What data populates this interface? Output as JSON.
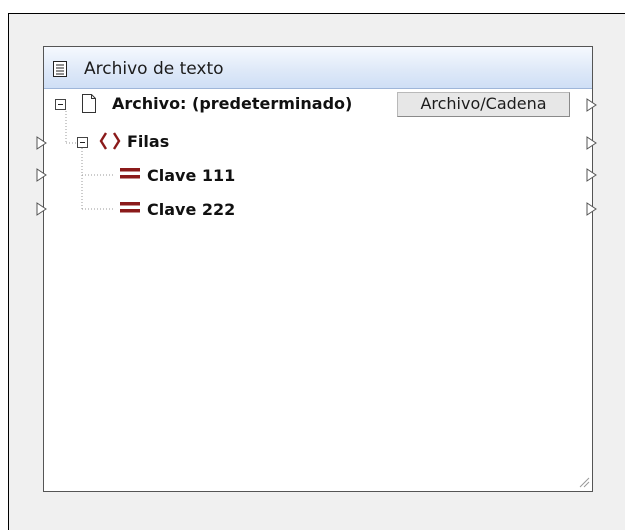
{
  "component": {
    "title": "Archivo de texto",
    "root": {
      "label": "Archivo: (predeterminado)",
      "button_label": "Archivo/Cadena"
    },
    "group": {
      "label": "Filas"
    },
    "fields": [
      {
        "label": "Clave 111"
      },
      {
        "label": "Clave 222"
      }
    ]
  },
  "icons": {
    "title": "text-file-icon",
    "root": "file-icon",
    "group": "braces-icon",
    "field": "equals-icon",
    "connector": "connector-triangle-icon",
    "collapse": "minus-box-icon",
    "resize": "resize-grip-icon"
  },
  "colors": {
    "titlebar_top": "#f6f9fe",
    "titlebar_bottom": "#cfdff6",
    "element_icon": "#8b1a1a",
    "canvas": "#f0f0f0"
  }
}
